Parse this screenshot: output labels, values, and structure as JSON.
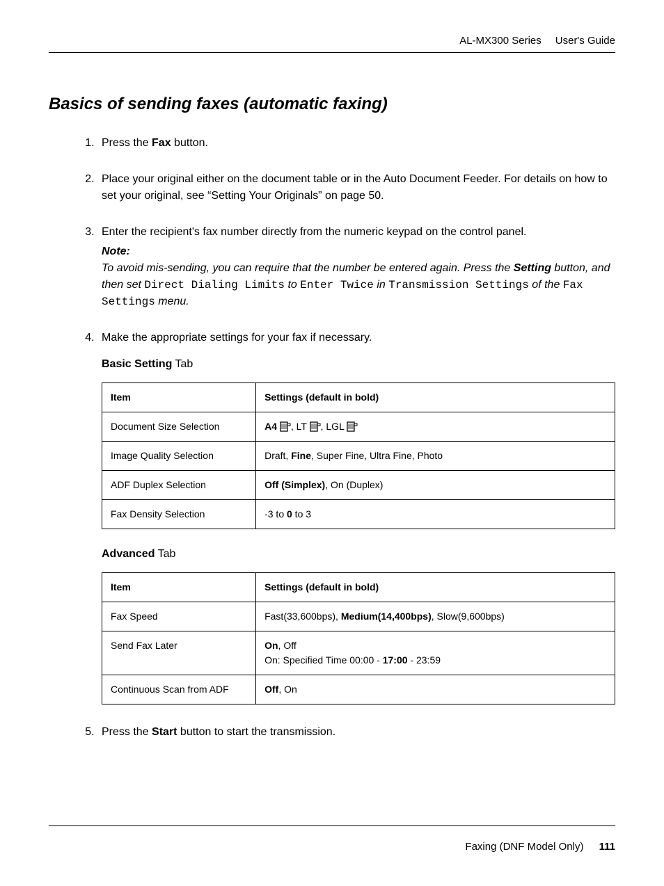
{
  "header": {
    "series": "AL-MX300 Series",
    "doc": "User's Guide"
  },
  "title": "Basics of sending faxes (automatic faxing)",
  "steps": {
    "s1_pre": "Press the ",
    "s1_bold": "Fax",
    "s1_post": " button.",
    "s2": "Place your original either on the document table or in the Auto Document Feeder. For details on how to set your original, see “Setting Your Originals” on page 50.",
    "s3": "Enter the recipient's fax number directly from the numeric keypad on the control panel.",
    "note_label": "Note:",
    "note_a": "To avoid mis-sending, you can require that the number be entered again. Press the ",
    "note_setting": "Setting",
    "note_b": " button, and then set ",
    "note_mono1": "Direct Dialing Limits",
    "note_c": " to ",
    "note_mono2": "Enter Twice",
    "note_d": " in ",
    "note_mono3": "Transmission Settings",
    "note_e": " of the ",
    "note_mono4": "Fax Settings",
    "note_f": " menu.",
    "s4": "Make the appropriate settings for your fax if necessary.",
    "s5_pre": "Press the ",
    "s5_bold": "Start",
    "s5_post": " button to start the transmission."
  },
  "basic_tab": {
    "heading_bold": "Basic Setting",
    "heading_plain": " Tab",
    "th_item": "Item",
    "th_settings": "Settings (default in bold)",
    "rows": {
      "r1_item": "Document Size Selection",
      "r1_a4": "A4",
      "r1_mid": ", LT ",
      "r1_end": ", LGL ",
      "r2_item": "Image Quality Selection",
      "r2_pre": "Draft, ",
      "r2_bold": "Fine",
      "r2_post": ", Super Fine, Ultra Fine, Photo",
      "r3_item": "ADF Duplex Selection",
      "r3_bold": "Off (Simplex)",
      "r3_post": ", On (Duplex)",
      "r4_item": "Fax Density Selection",
      "r4_pre": "-3 to ",
      "r4_bold": "0",
      "r4_post": " to 3"
    }
  },
  "adv_tab": {
    "heading_bold": "Advanced",
    "heading_plain": " Tab",
    "th_item": "Item",
    "th_settings": "Settings (default in bold)",
    "rows": {
      "r1_item": "Fax Speed",
      "r1_pre": "Fast(33,600bps), ",
      "r1_bold": "Medium(14,400bps)",
      "r1_post": ", Slow(9,600bps)",
      "r2_item": "Send Fax Later",
      "r2_on": "On",
      "r2_off_post": ", Off",
      "r2_l2_pre": "On: Specified Time 00:00 - ",
      "r2_l2_bold": "17:00",
      "r2_l2_post": " - 23:59",
      "r3_item": "Continuous Scan from ADF",
      "r3_bold": "Off",
      "r3_post": ", On"
    }
  },
  "footer": {
    "chapter": "Faxing (DNF Model Only)",
    "page": "111"
  }
}
